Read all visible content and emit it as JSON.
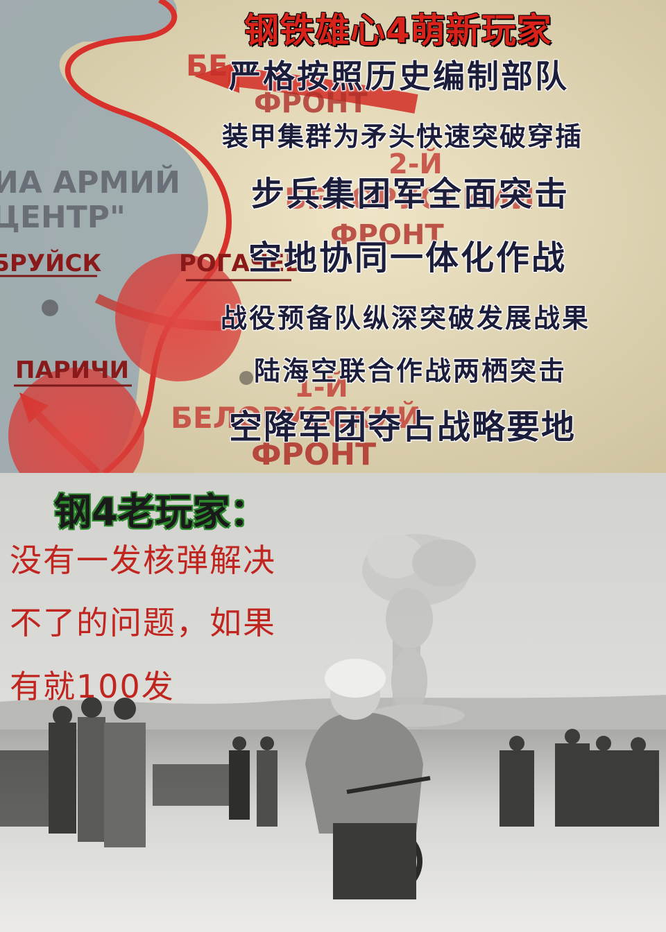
{
  "top_panel": {
    "title": "钢铁雄心4萌新玩家",
    "lines": [
      "严格按照历史编制部队",
      "装甲集群为矛头快速突破穿插",
      "步兵集团军全面突击",
      "空地协同一体化作战",
      "战役预备队纵深突破发展战果",
      "陆海空联合作战两栖突击",
      "空降军团夺占战略要地"
    ],
    "map_labels": {
      "armii": "ИА АРМИЙ",
      "center": "ЦЕНТР\"",
      "bobruisk": "БРУЙСК",
      "rogachev": "РОГАЧЕВ",
      "parichi": "ПАРИЧИ",
      "be1": "БЕ",
      "front1": "ФРОНТ",
      "second": "2-Й",
      "belorussky": "БЕЛОРУССКИЙ",
      "front2": "ФРОНТ",
      "first": "1-Й",
      "be2": "БЕЛОРУССКИЙ",
      "front3": "ФРОНТ"
    }
  },
  "bottom_panel": {
    "title": "钢4老玩家：",
    "quote_lines": [
      "没有一发核弹解决",
      "不了的问题，如果",
      "有就100发"
    ]
  }
}
